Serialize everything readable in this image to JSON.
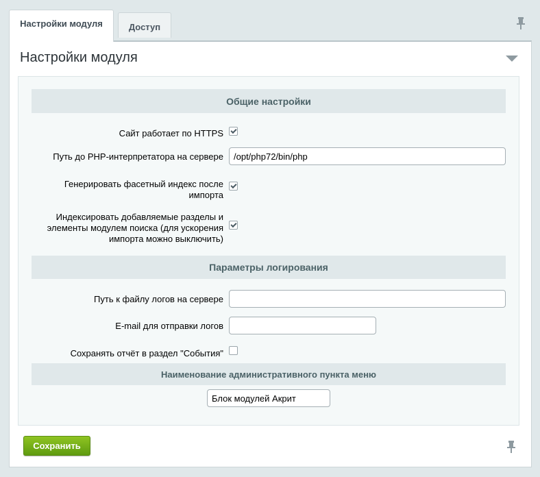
{
  "tabs": [
    {
      "label": "Настройки модуля",
      "active": true
    },
    {
      "label": "Доступ",
      "active": false
    }
  ],
  "page_title": "Настройки модуля",
  "sections": {
    "general": "Общие настройки",
    "logging": "Параметры логирования",
    "menu": "Наименование административного пункта меню"
  },
  "fields": {
    "https_label": "Сайт работает по HTTPS",
    "https_checked": true,
    "php_path_label": "Путь до PHP-интерпретатора на сервере",
    "php_path_value": "/opt/php72/bin/php",
    "facet_label": "Генерировать фасетный индекс после импорта",
    "facet_checked": true,
    "index_label": "Индексировать добавляемые разделы и элементы модулем поиска (для ускорения импорта можно выключить)",
    "index_checked": true,
    "log_path_label": "Путь к файлу логов на сервере",
    "log_path_value": "",
    "email_label": "E-mail для отправки логов",
    "email_value": "",
    "events_label": "Сохранять отчёт в раздел \"События\"",
    "events_checked": false,
    "menu_name_value": "Блок модулей Акрит"
  },
  "buttons": {
    "save": "Сохранить"
  },
  "icons": {
    "pin": "pin-icon",
    "collapse": "collapse-arrow-icon"
  }
}
